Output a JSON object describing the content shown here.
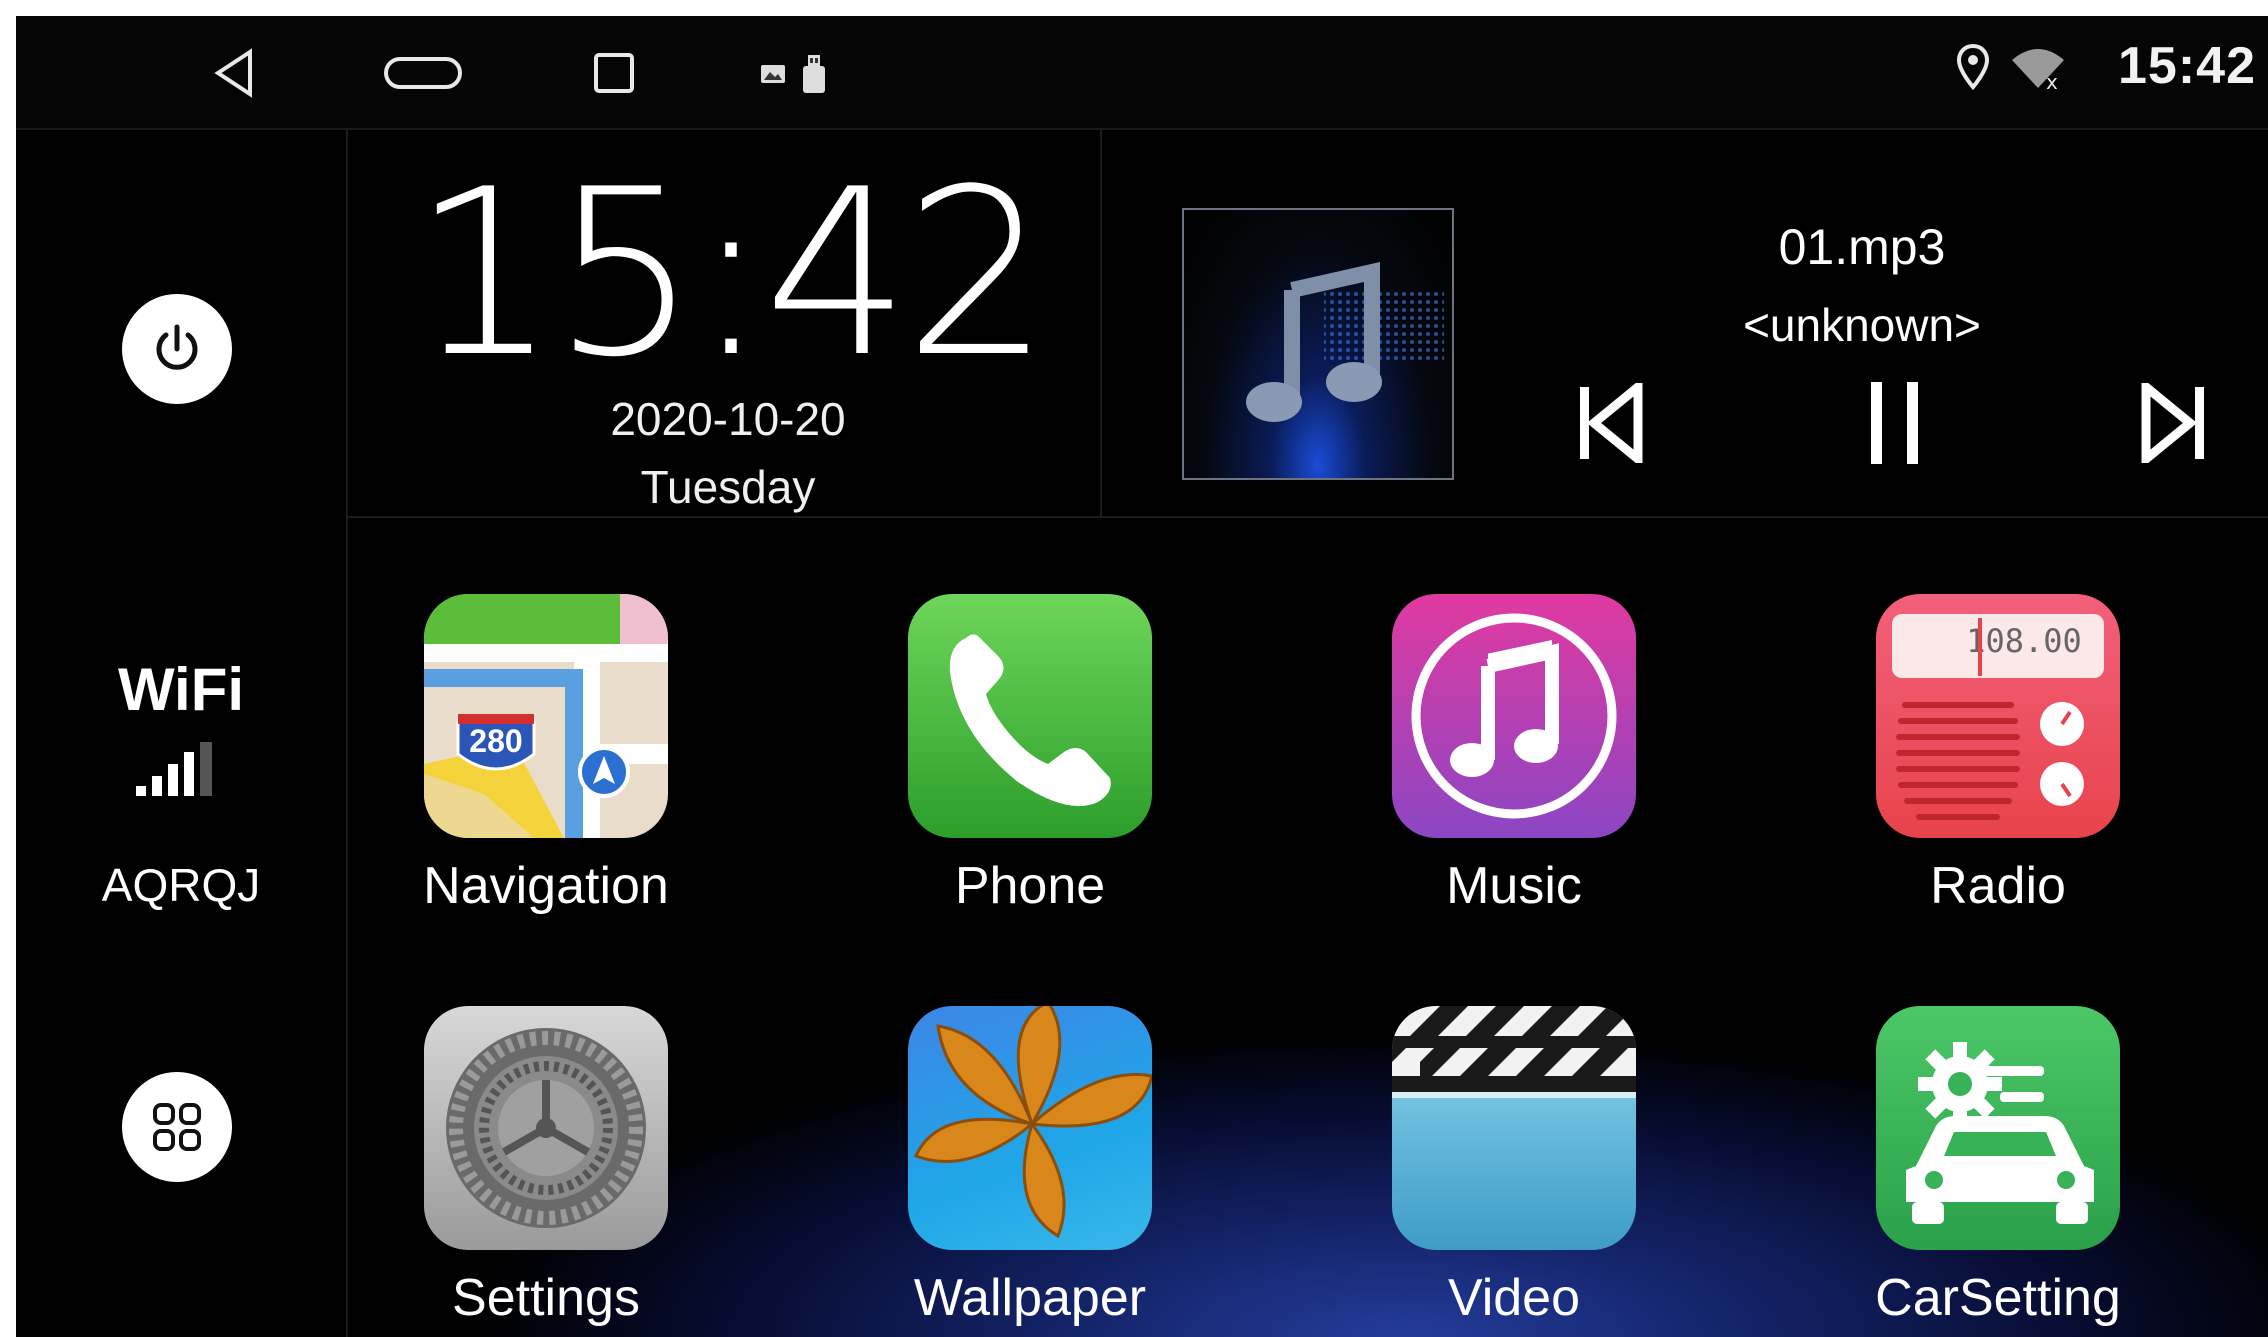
{
  "status_bar": {
    "time": "15:42",
    "icons": [
      "back-icon",
      "home-icon",
      "recents-icon",
      "image-icon",
      "usb-icon",
      "location-icon",
      "wifi-disconnected-icon"
    ]
  },
  "left_rail": {
    "wifi_title": "WiFi",
    "wifi_ssid": "AQRQJ",
    "icons": [
      "power-icon",
      "wifi-signal-icon",
      "all-apps-icon"
    ]
  },
  "clock": {
    "time": "15:42",
    "date": "2020-10-20",
    "day": "Tuesday"
  },
  "music": {
    "title": "01.mp3",
    "artist": "<unknown>",
    "controls": [
      "previous-icon",
      "pause-icon",
      "next-icon"
    ]
  },
  "apps": [
    {
      "label": "Navigation",
      "icon": "navigation-icon",
      "badge": "280"
    },
    {
      "label": "Phone",
      "icon": "phone-icon"
    },
    {
      "label": "Music",
      "icon": "music-icon"
    },
    {
      "label": "Radio",
      "icon": "radio-icon",
      "freq": "108.00"
    },
    {
      "label": "Settings",
      "icon": "settings-icon"
    },
    {
      "label": "Wallpaper",
      "icon": "wallpaper-icon"
    },
    {
      "label": "Video",
      "icon": "video-icon"
    },
    {
      "label": "CarSetting",
      "icon": "car-setting-icon"
    }
  ],
  "colors": {
    "phone": "#3cb83a",
    "music": "#b03fb8",
    "radio": "#ef4f5e",
    "carsetting": "#34b050",
    "video": "#6ec3e0"
  }
}
